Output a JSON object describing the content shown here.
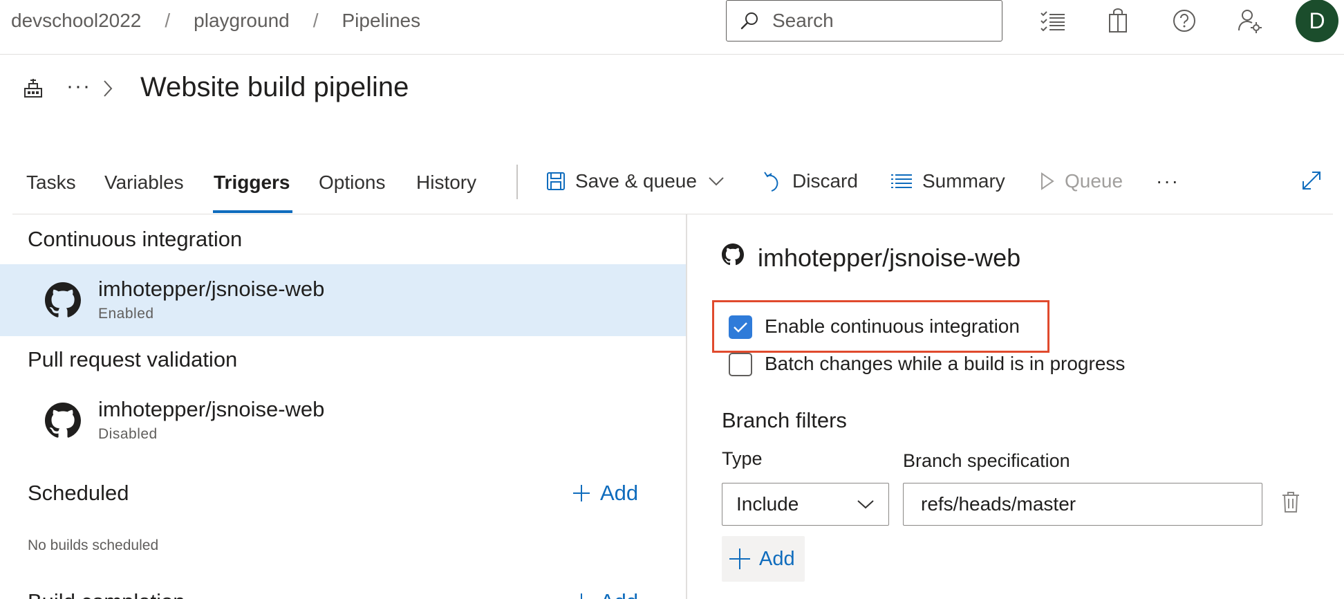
{
  "breadcrumb": {
    "org": "devschool2022",
    "project": "playground",
    "section": "Pipelines",
    "separator": "/"
  },
  "search": {
    "placeholder": "Search"
  },
  "user": {
    "initial": "D",
    "avatar_color": "#1b4d2c"
  },
  "pipeline": {
    "title": "Website build pipeline",
    "ellipsis": "···"
  },
  "tabs": [
    {
      "label": "Tasks",
      "active": false
    },
    {
      "label": "Variables",
      "active": false
    },
    {
      "label": "Triggers",
      "active": true
    },
    {
      "label": "Options",
      "active": false
    },
    {
      "label": "History",
      "active": false
    }
  ],
  "toolbar": {
    "save_queue": "Save & queue",
    "discard": "Discard",
    "summary": "Summary",
    "queue": "Queue",
    "more": "···"
  },
  "left": {
    "ci_heading": "Continuous integration",
    "ci_repo": {
      "name": "imhotepper/jsnoise-web",
      "status": "Enabled"
    },
    "pr_heading": "Pull request validation",
    "pr_repo": {
      "name": "imhotepper/jsnoise-web",
      "status": "Disabled"
    },
    "scheduled_heading": "Scheduled",
    "scheduled_add": "Add",
    "scheduled_empty": "No builds scheduled",
    "completion_heading": "Build completion",
    "completion_add": "Add"
  },
  "right": {
    "repo_title": "imhotepper/jsnoise-web",
    "enable_ci": {
      "label": "Enable continuous integration",
      "checked": true
    },
    "batch": {
      "label": "Batch changes while a build is in progress",
      "checked": false
    },
    "branch_filters_heading": "Branch filters",
    "type_label": "Type",
    "type_value": "Include",
    "branch_spec_label": "Branch specification",
    "branch_spec_value": "refs/heads/master",
    "add_label": "Add"
  },
  "colors": {
    "accent": "#0f6cbd",
    "selected_row": "#deecf9",
    "highlight_box": "#e04a2d",
    "checkbox": "#2f7bd9"
  }
}
